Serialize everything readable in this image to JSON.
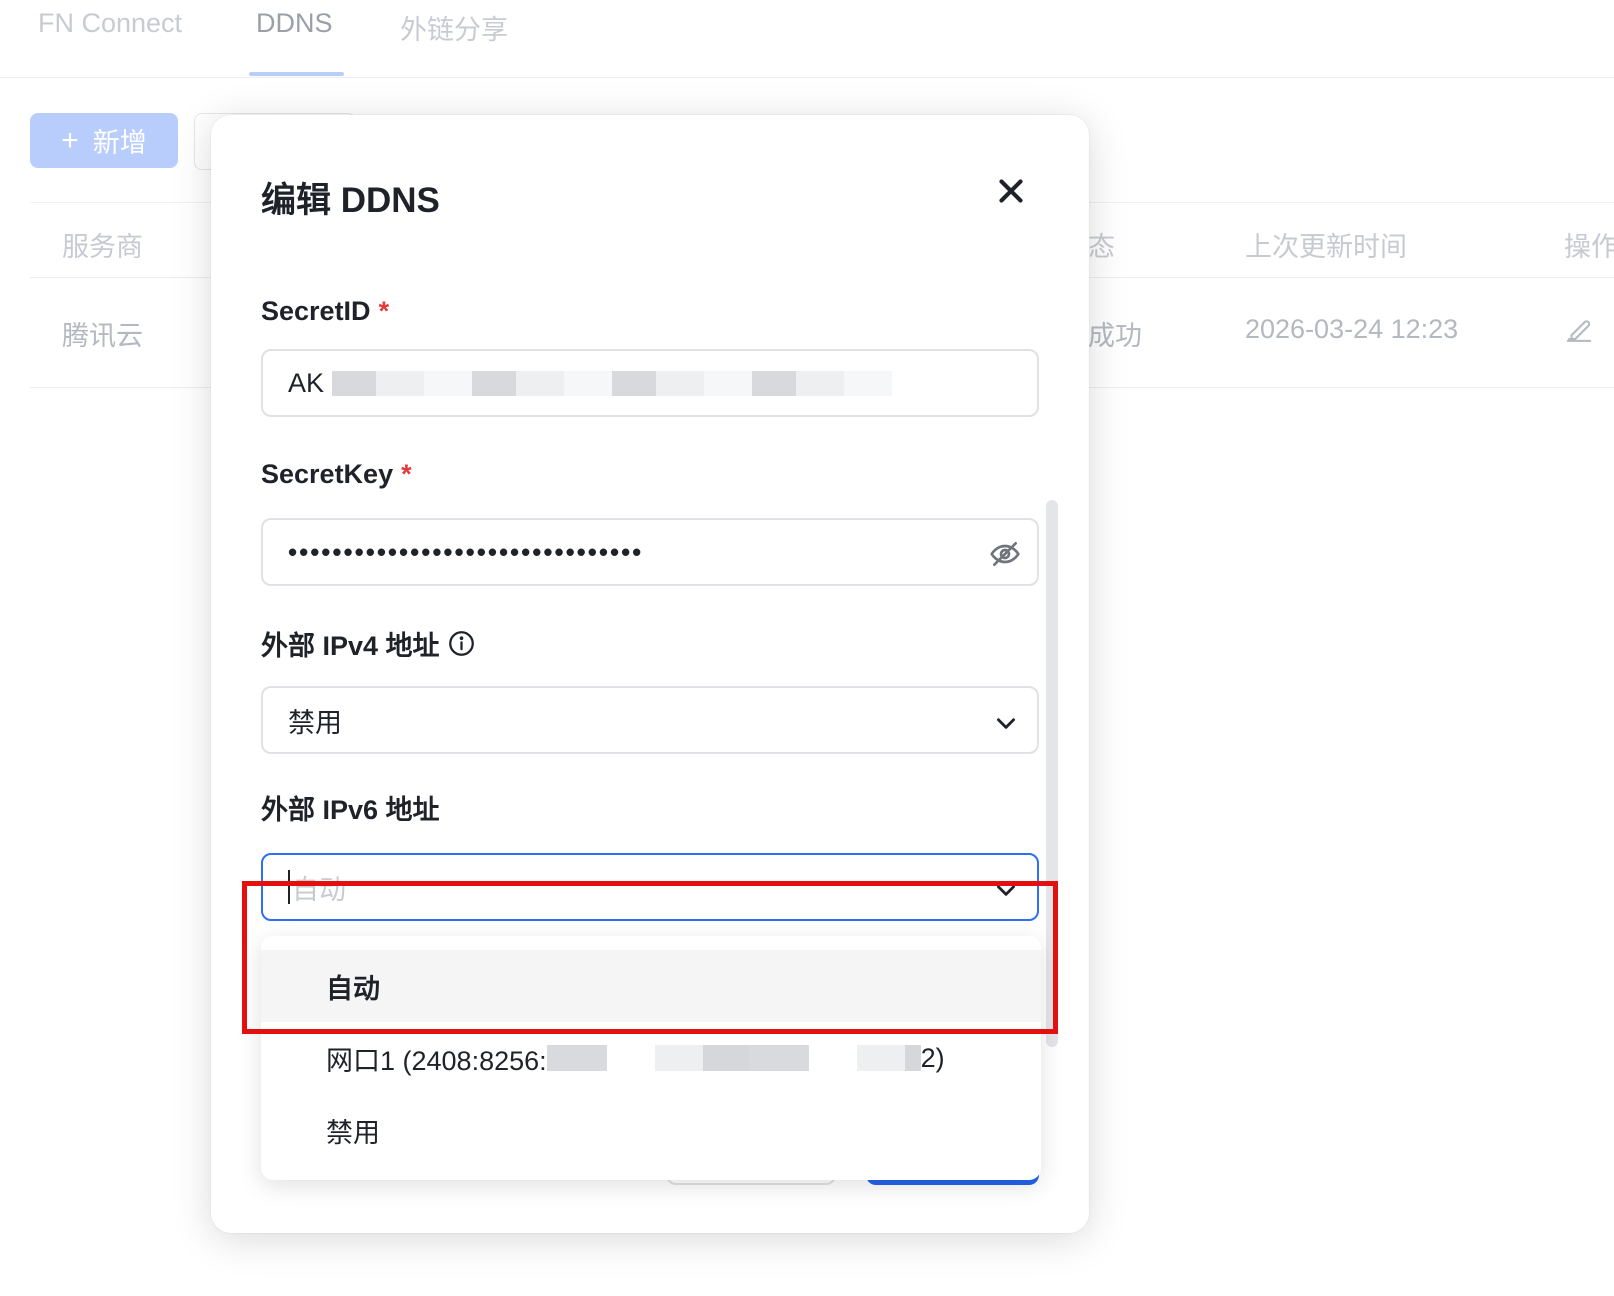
{
  "tabs": [
    {
      "label": "FN Connect"
    },
    {
      "label": "DDNS"
    },
    {
      "label": "外链分享"
    }
  ],
  "toolbar": {
    "add_label": "新增",
    "add_icon": "plus-icon"
  },
  "table": {
    "headers": [
      "服务商",
      "态",
      "上次更新时间",
      "操作"
    ],
    "rows": [
      {
        "provider": "腾讯云",
        "status": "成功",
        "updated": "2026-03-24 12:23",
        "action_icon": "edit-icon"
      }
    ]
  },
  "modal": {
    "title": "编辑 DDNS",
    "fields": {
      "secret_id": {
        "label": "SecretID",
        "required": "*",
        "value_prefix": "AK"
      },
      "secret_key": {
        "label": "SecretKey",
        "required": "*",
        "value": "••••••••••••••••••••••••••••••••"
      },
      "ipv4": {
        "label": "外部 IPv4 地址",
        "value": "禁用"
      },
      "ipv6": {
        "label": "外部 IPv6 地址",
        "placeholder": "自动"
      }
    },
    "dropdown": {
      "options": [
        {
          "label": "自动",
          "selected": true
        },
        {
          "label_prefix": "网口1 (2408:8256:",
          "label_suffix": "2)"
        },
        {
          "label": "禁用"
        }
      ]
    }
  },
  "colors": {
    "primary": "#2563eb",
    "focus_border": "#2f6ef6",
    "required": "#e5383b",
    "annotation": "#e41010"
  }
}
